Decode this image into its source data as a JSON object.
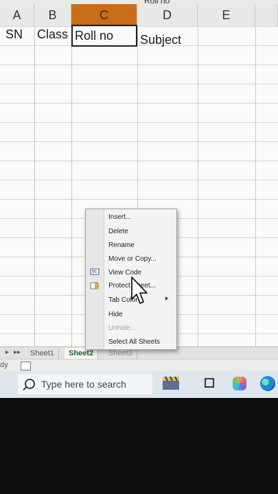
{
  "namebox": {
    "value": "Roll no"
  },
  "columns": [
    {
      "letter": "A",
      "selected": false
    },
    {
      "letter": "B",
      "selected": false
    },
    {
      "letter": "C",
      "selected": true
    },
    {
      "letter": "D",
      "selected": false
    },
    {
      "letter": "E",
      "selected": false
    }
  ],
  "row1": {
    "A": "SN",
    "B": "Class",
    "C": "Roll no",
    "D": "Subject"
  },
  "context_menu": {
    "items": [
      {
        "label": "Insert...",
        "enabled": true
      },
      {
        "label": "Delete",
        "enabled": true
      },
      {
        "label": "Rename",
        "enabled": true
      },
      {
        "label": "Move or Copy...",
        "enabled": true
      },
      {
        "label": "View Code",
        "enabled": true,
        "icon": "view-code-icon"
      },
      {
        "label": "Protect Sheet...",
        "enabled": true,
        "icon": "protect-sheet-icon"
      },
      {
        "label": "Tab Color",
        "enabled": true,
        "has_submenu": true
      },
      {
        "label": "Hide",
        "enabled": true
      },
      {
        "label": "Unhide...",
        "enabled": false
      },
      {
        "label": "Select All Sheets",
        "enabled": true
      }
    ]
  },
  "sheet_tabs": [
    {
      "label": "Sheet1",
      "active": false
    },
    {
      "label": "Sheet2",
      "active": true
    },
    {
      "label": "Sheet3",
      "active": false
    }
  ],
  "status": {
    "text": "dy"
  },
  "taskbar": {
    "search_placeholder": "Type here to search",
    "icons": [
      "search-icon",
      "clapper-icon",
      "task-view-icon",
      "copilot-icon",
      "edge-icon"
    ]
  },
  "colors": {
    "selected_header": "#c96d1a",
    "active_tab_text": "#1f5f2e",
    "taskbar_bg": "#dfe6ee"
  }
}
